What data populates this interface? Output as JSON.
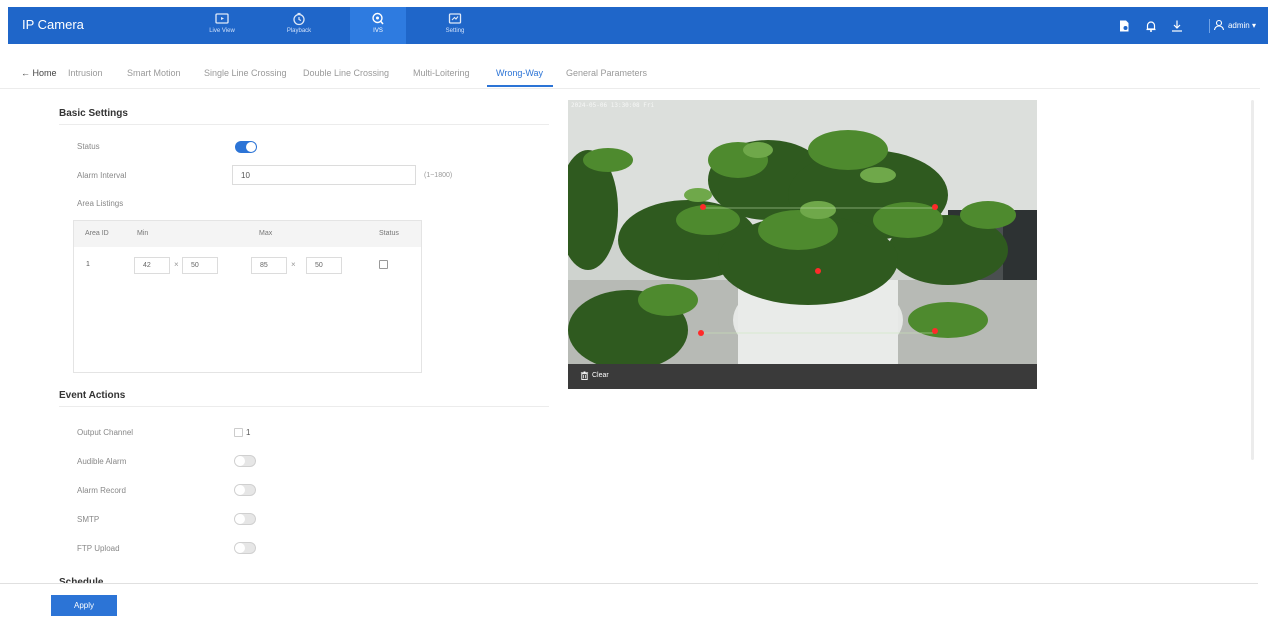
{
  "header": {
    "app_title": "IP Camera",
    "nav": [
      {
        "label": "Live View",
        "icon": "live-view-icon"
      },
      {
        "label": "Playback",
        "icon": "playback-icon"
      },
      {
        "label": "IVS",
        "icon": "ivs-icon"
      },
      {
        "label": "Setting",
        "icon": "setting-icon"
      }
    ],
    "user": "admin ▾"
  },
  "tabs": {
    "home": "← Home",
    "items": [
      "Intrusion",
      "Smart Motion",
      "Single Line Crossing",
      "Double Line Crossing",
      "Multi-Loitering",
      "Wrong-Way",
      "General Parameters"
    ],
    "active": "Wrong-Way"
  },
  "basic": {
    "title": "Basic Settings",
    "status_label": "Status",
    "status_on": true,
    "alarm_interval_label": "Alarm Interval",
    "alarm_interval_value": "10",
    "alarm_interval_hint": "(1~1800)",
    "area_listings_label": "Area Listings",
    "table": {
      "headers": [
        "Area ID",
        "Min",
        "Max",
        "Status"
      ],
      "rows": [
        {
          "id": "1",
          "min_w": "42",
          "min_h": "50",
          "max_w": "85",
          "max_h": "50",
          "checked": false
        }
      ]
    }
  },
  "video": {
    "osd": "2024-05-06 13:30:08 Fri",
    "clear_label": "Clear"
  },
  "event": {
    "title": "Event Actions",
    "output_channel_label": "Output Channel",
    "output_channel_value": "1",
    "audible_alarm_label": "Audible Alarm",
    "alarm_record_label": "Alarm Record",
    "smtp_label": "SMTP",
    "ftp_upload_label": "FTP Upload"
  },
  "schedule": {
    "title": "Schedule"
  },
  "footer": {
    "apply_label": "Apply"
  },
  "colors": {
    "accent": "#1f66c9",
    "active_tab": "#2c74d6"
  }
}
